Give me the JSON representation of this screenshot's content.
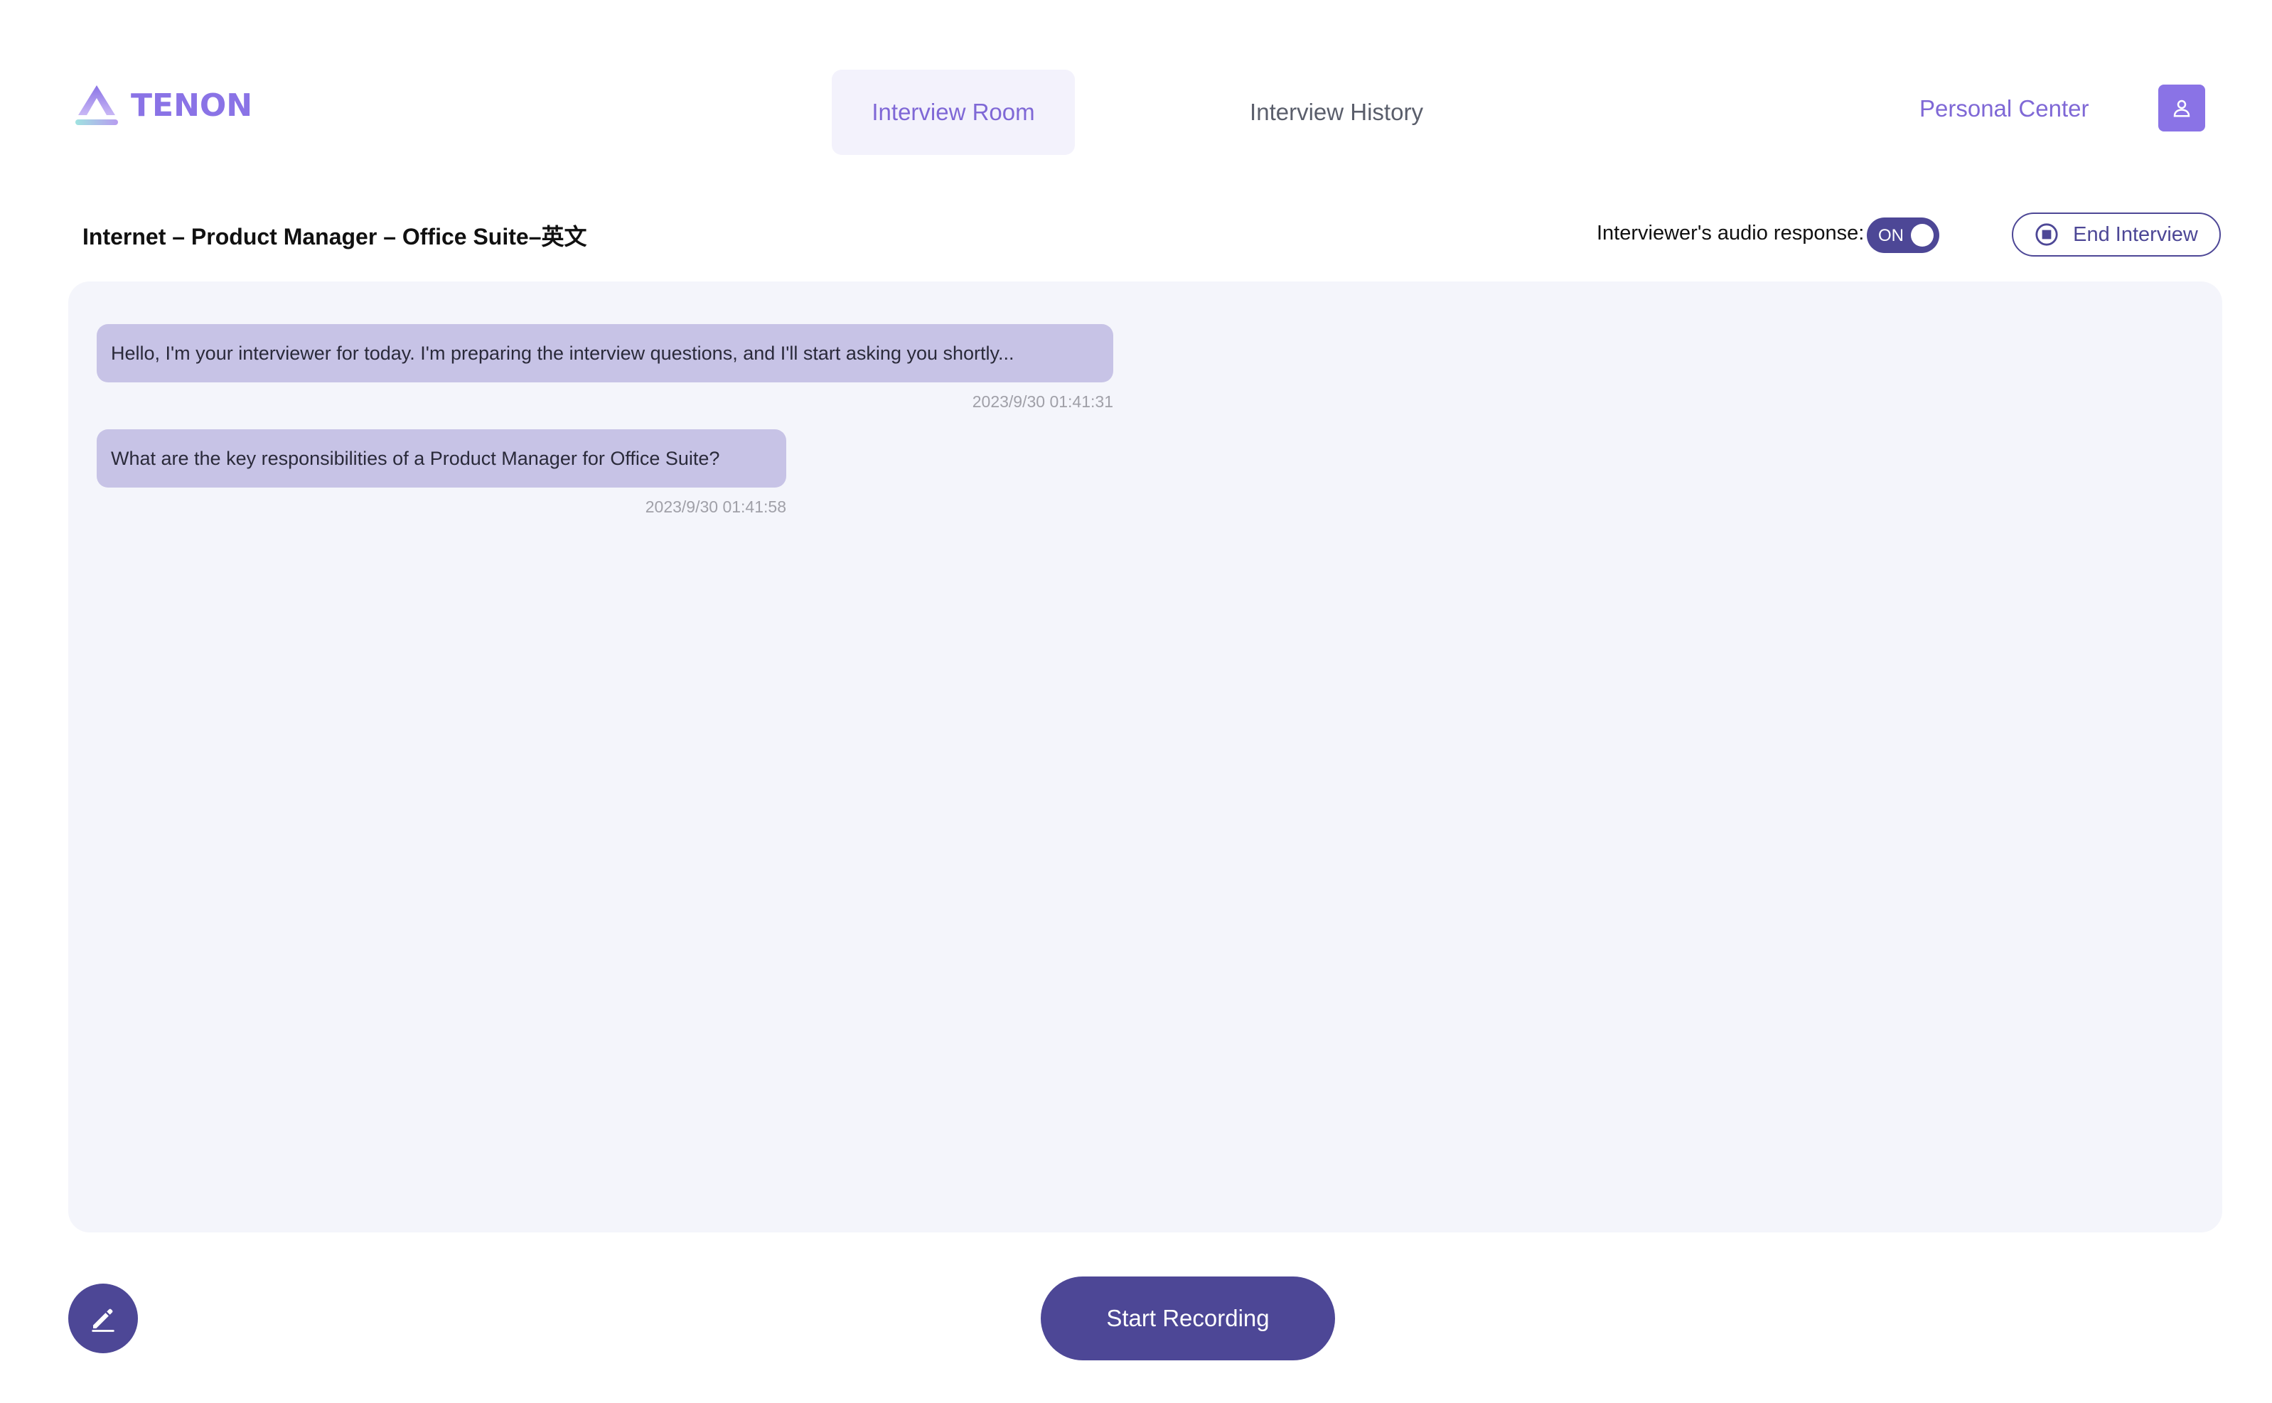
{
  "header": {
    "logo_text": "TENON",
    "tabs": [
      {
        "label": "Interview Room",
        "active": true
      },
      {
        "label": "Interview History",
        "active": false
      }
    ],
    "personal_center": "Personal Center",
    "avatar_icon": "user-icon"
  },
  "session": {
    "title": "Internet – Product Manager – Office Suite–英文",
    "audio_label": "Interviewer's audio response:",
    "audio_toggle": "ON",
    "end_button": "End Interview",
    "end_icon": "stop-circle-icon"
  },
  "messages": [
    {
      "text": "Hello, I'm your interviewer for today. I'm preparing the interview questions, and I'll start asking you shortly...",
      "time": "2023/9/30 01:41:31"
    },
    {
      "text": "What are the key responsibilities of a Product Manager for Office Suite?",
      "time": "2023/9/30 01:41:58"
    }
  ],
  "footer": {
    "edit_icon": "pencil-icon",
    "record_button": "Start Recording"
  },
  "colors": {
    "accent": "#8a73e6",
    "primary_dark": "#4d4796",
    "bubble": "#c7c3e6",
    "panel": "#f4f5fb"
  }
}
